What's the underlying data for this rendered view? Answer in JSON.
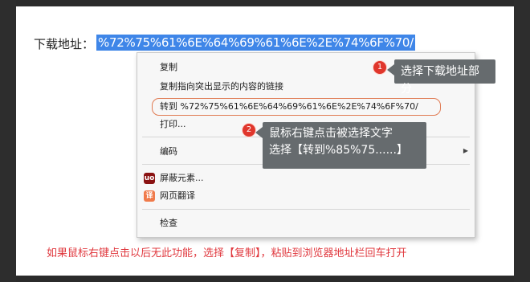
{
  "address": {
    "label": "下载地址：",
    "value": "%72%75%61%6E%64%69%61%6E%2E%74%6F%70/"
  },
  "menu": {
    "copy": "复制",
    "copy_link": "复制指向突出显示的内容的链接",
    "goto": "转到 %72%75%61%6E%64%69%61%6E%2E%74%6F%70/",
    "print": "打印...",
    "encoding": "编码",
    "block": "屏蔽元素...",
    "translate": "网页翻译",
    "inspect": "检查",
    "block_icon": "uo",
    "translate_icon": "译"
  },
  "callouts": {
    "badge1": "1",
    "text1": "选择下载地址部分",
    "badge2": "2",
    "text2_line1": "鼠标右键点击被选择文字",
    "text2_line2": "选择【转到%85%75......】"
  },
  "note": "如果鼠标右键点击以后无此功能，选择【复制】，粘贴到浏览器地址栏回车打开",
  "colors": {
    "selection": "#3f86e8",
    "callout_bg": "#666b6e",
    "badge": "#e0362c",
    "note": "#e0383e",
    "highlight_outline": "#e07a52"
  }
}
